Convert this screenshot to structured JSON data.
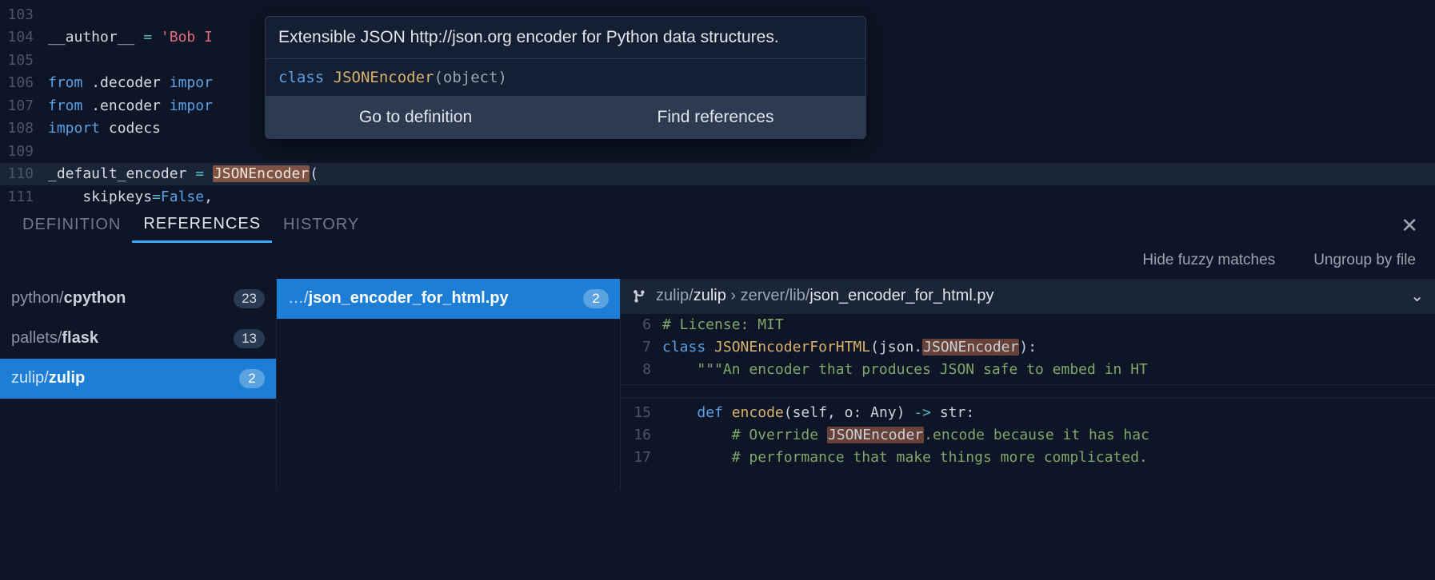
{
  "editor": {
    "lines": [
      {
        "num": 103,
        "tokens": []
      },
      {
        "num": 104,
        "tokens": [
          [
            "nm",
            "__author__ "
          ],
          [
            "op",
            "="
          ],
          [
            "pl",
            " "
          ],
          [
            "st",
            "'Bob I"
          ]
        ]
      },
      {
        "num": 105,
        "tokens": []
      },
      {
        "num": 106,
        "tokens": [
          [
            "kw",
            "from "
          ],
          [
            "mod",
            ".decoder "
          ],
          [
            "kw",
            "impor"
          ]
        ]
      },
      {
        "num": 107,
        "tokens": [
          [
            "kw",
            "from "
          ],
          [
            "mod",
            ".encoder "
          ],
          [
            "kw",
            "impor"
          ]
        ]
      },
      {
        "num": 108,
        "tokens": [
          [
            "kw",
            "import "
          ],
          [
            "mod",
            "codecs"
          ]
        ]
      },
      {
        "num": 109,
        "tokens": []
      },
      {
        "num": 110,
        "hl": true,
        "tokens": [
          [
            "nm",
            "_default_encoder "
          ],
          [
            "op",
            "="
          ],
          [
            "pl",
            " "
          ],
          [
            "tokhl",
            "JSONEncoder"
          ],
          [
            "pl",
            "("
          ]
        ]
      },
      {
        "num": 111,
        "tokens": [
          [
            "pl",
            "    "
          ],
          [
            "nm",
            "skipkeys"
          ],
          [
            "op",
            "="
          ],
          [
            "kw",
            "False"
          ],
          [
            "pl",
            ","
          ]
        ]
      }
    ]
  },
  "hover": {
    "doc": "Extensible JSON http://json.org encoder for Python data structures.",
    "sig_tokens": [
      [
        "sig-kw",
        "class "
      ],
      [
        "sig-nm",
        "JSONEncoder"
      ],
      [
        "sig-pl",
        "(object)"
      ]
    ],
    "go_to_def": "Go to definition",
    "find_refs": "Find references"
  },
  "panel": {
    "tabs": {
      "definition": "Definition",
      "references": "References",
      "history": "History"
    },
    "toolbar": {
      "hide_fuzzy": "Hide fuzzy matches",
      "ungroup": "Ungroup by file"
    },
    "repos": [
      {
        "prefix": "python/",
        "name": "cpython",
        "count": "23"
      },
      {
        "prefix": "pallets/",
        "name": "flask",
        "count": "13"
      },
      {
        "prefix": "zulip/",
        "name": "zulip",
        "count": "2",
        "selected": true
      }
    ],
    "files": [
      {
        "prefix": "…/",
        "name": "json_encoder_for_html.py",
        "count": "2",
        "selected": true
      }
    ],
    "preview": {
      "breadcrumb": {
        "repo_prefix": "zulip/",
        "repo": "zulip",
        "sep": " › ",
        "path": "zerver/lib/",
        "file": "json_encoder_for_html.py"
      },
      "lines1": [
        {
          "num": 6,
          "tokens": [
            [
              "cm",
              "# License: MIT"
            ]
          ]
        },
        {
          "num": 7,
          "tokens": [
            [
              "kw",
              "class "
            ],
            [
              "ty",
              "JSONEncoderForHTML"
            ],
            [
              "pl",
              "(json."
            ],
            [
              "tok-ref-hl",
              "JSONEncoder"
            ],
            [
              "pl",
              "):"
            ]
          ]
        },
        {
          "num": 8,
          "tokens": [
            [
              "pl",
              "    "
            ],
            [
              "doc",
              "\"\"\"An encoder that produces JSON safe to embed in HT"
            ]
          ]
        }
      ],
      "lines2": [
        {
          "num": 15,
          "tokens": [
            [
              "pl",
              "    "
            ],
            [
              "kw",
              "def "
            ],
            [
              "ty",
              "encode"
            ],
            [
              "pl",
              "(self, o: Any) "
            ],
            [
              "op",
              "->"
            ],
            [
              "pl",
              " str:"
            ]
          ]
        },
        {
          "num": 16,
          "tokens": [
            [
              "pl",
              "        "
            ],
            [
              "cm",
              "# Override "
            ],
            [
              "tok-ref-hl",
              "JSONEncoder"
            ],
            [
              "cm",
              ".encode because it has hac"
            ]
          ]
        },
        {
          "num": 17,
          "tokens": [
            [
              "pl",
              "        "
            ],
            [
              "cm",
              "# performance that make things more complicated."
            ]
          ]
        }
      ]
    }
  }
}
